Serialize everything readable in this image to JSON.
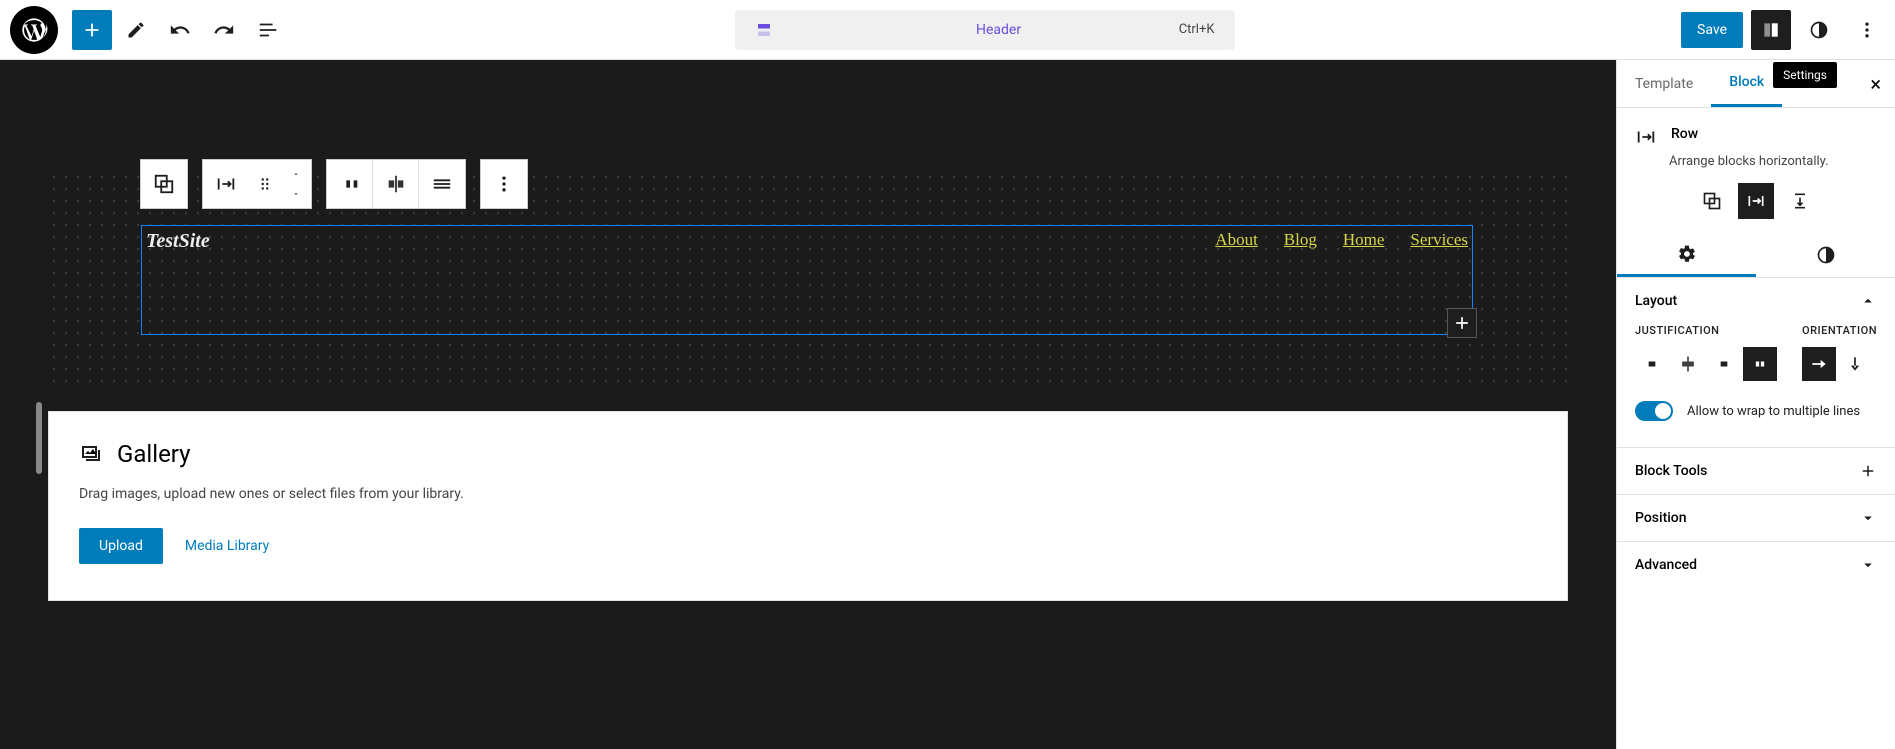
{
  "toolbar": {
    "document_label": "Header",
    "shortcut": "Ctrl+K",
    "save_label": "Save",
    "tooltip": "Settings"
  },
  "canvas": {
    "site_title": "TestSite",
    "nav": [
      "About",
      "Blog",
      "Home",
      "Services"
    ],
    "gallery": {
      "title": "Gallery",
      "description": "Drag images, upload new ones or select files from your library.",
      "upload_label": "Upload",
      "media_label": "Media Library"
    }
  },
  "sidebar": {
    "tabs": {
      "template": "Template",
      "block": "Block"
    },
    "block": {
      "name": "Row",
      "description": "Arrange blocks horizontally."
    },
    "panels": {
      "layout": {
        "title": "Layout",
        "justification_label": "Justification",
        "orientation_label": "Orientation",
        "wrap_label": "Allow to wrap to multiple lines"
      },
      "block_tools": "Block Tools",
      "position": "Position",
      "advanced": "Advanced"
    }
  }
}
